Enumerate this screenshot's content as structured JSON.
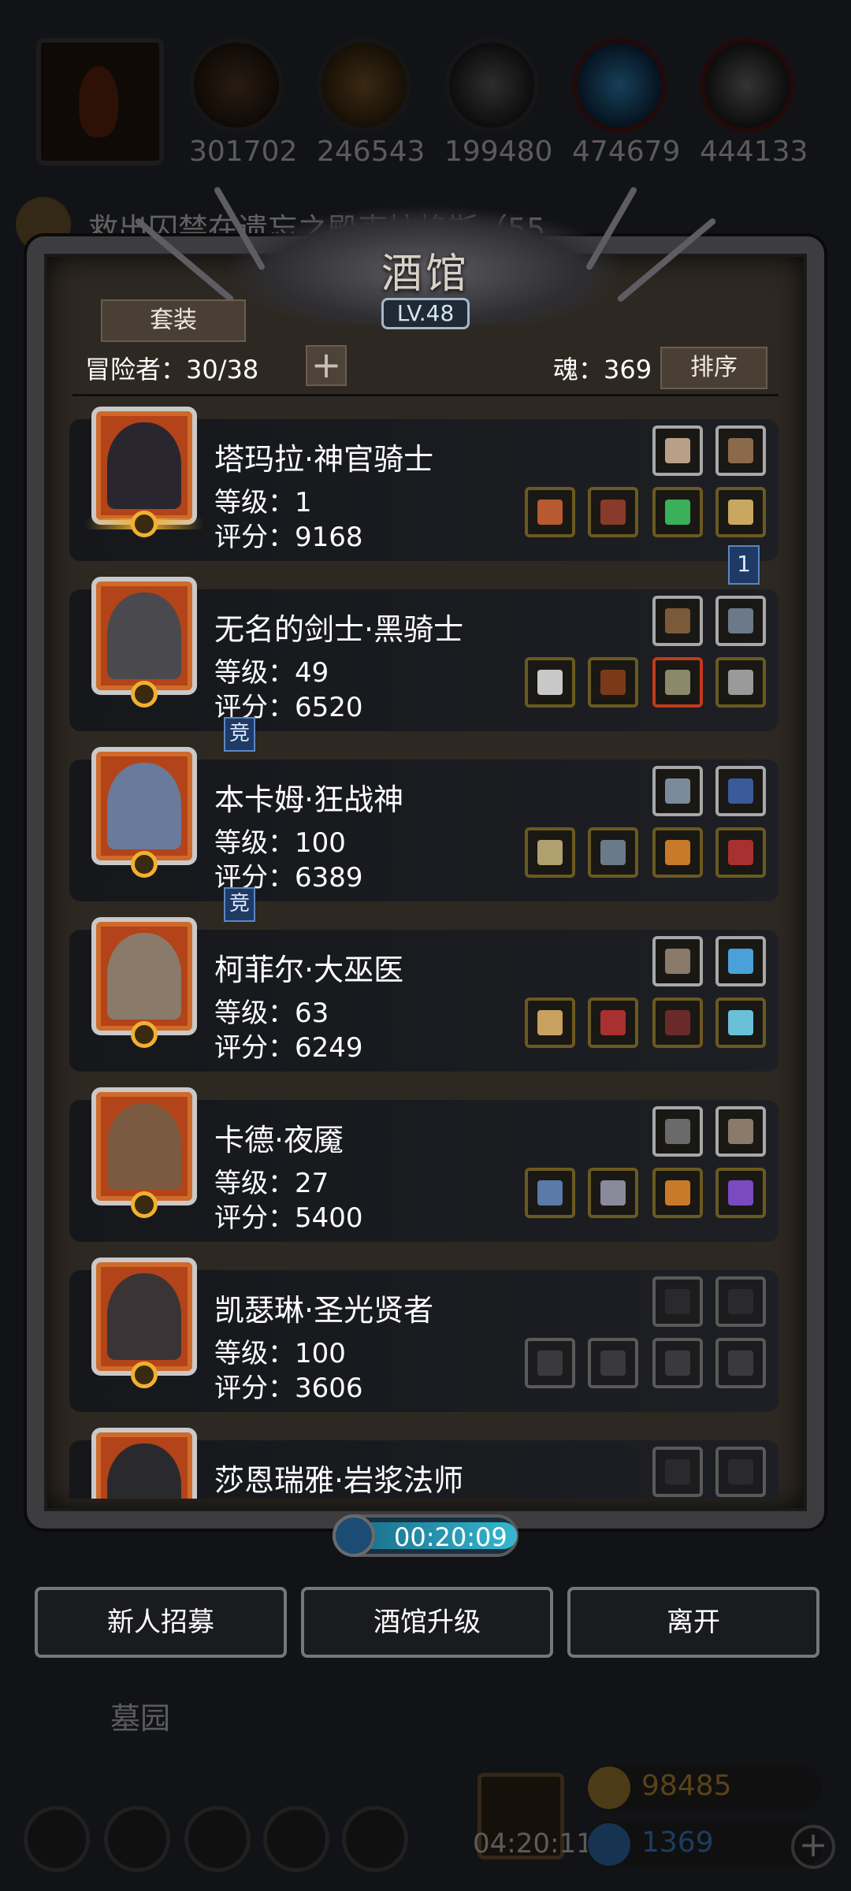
{
  "resources": [
    {
      "icon": "leather-icon",
      "value": "301702"
    },
    {
      "icon": "wood-icon",
      "value": "246543"
    },
    {
      "icon": "iron-icon",
      "value": "199480"
    },
    {
      "icon": "crystal-icon",
      "value": "474679"
    },
    {
      "icon": "stone-icon",
      "value": "444133"
    }
  ],
  "quest": {
    "text": "救出囚禁在遗忘之殿克拉格斯（55"
  },
  "panel": {
    "title": "酒馆",
    "level": "LV.48",
    "set_button": "套装",
    "adventurers": "冒险者：30/38",
    "souls": "魂：369",
    "sort_button": "排序"
  },
  "heroes": [
    {
      "name": "塔玛拉·神官骑士",
      "level": "等级：1",
      "score": "评分：9168",
      "face": "#2a2630",
      "gear": [
        "#b8a088",
        "#8a6a4a",
        "#b85a30",
        "#8a3a2a",
        "#3ab05a",
        "#c8a860"
      ],
      "gear_borders": [
        "silver",
        "silver",
        "gold",
        "gold",
        "gold",
        "gold"
      ]
    },
    {
      "name": "无名的剑士·黑骑士",
      "level": "等级：49",
      "score": "评分：6520",
      "face": "#4a4a4e",
      "gear": [
        "#7a5a3a",
        "#6a7a8a",
        "#c8c8c8",
        "#7a3a1a",
        "#8a8a6a",
        "#9a9a9a"
      ],
      "gear_borders": [
        "silver",
        "silver",
        "gold",
        "gold",
        "red",
        "gold"
      ]
    },
    {
      "name": "本卡姆·狂战神",
      "level": "等级：100",
      "score": "评分：6389",
      "face": "#6a7a9a",
      "gear": [
        "#7a8a9a",
        "#3a5a9a",
        "#b0a070",
        "#6a7a8a",
        "#c87a2a",
        "#a83030"
      ],
      "gear_borders": [
        "silver",
        "silver",
        "gold",
        "gold",
        "gold",
        "gold"
      ]
    },
    {
      "name": "柯菲尔·大巫医",
      "level": "等级：63",
      "score": "评分：6249",
      "face": "#8a7a6a",
      "gear": [
        "#8a7a6a",
        "#4aa0d8",
        "#c8a060",
        "#a83030",
        "#6a2a2a",
        "#6ac0d8"
      ],
      "gear_borders": [
        "silver",
        "silver",
        "gold",
        "gold",
        "gold",
        "gold"
      ]
    },
    {
      "name": "卡德·夜魇",
      "level": "等级：27",
      "score": "评分：5400",
      "face": "#7a5a40",
      "gear": [
        "#6a6a6a",
        "#8a7a6a",
        "#5a7aa8",
        "#8a8a9a",
        "#c87a2a",
        "#7a4ac0"
      ],
      "gear_borders": [
        "silver",
        "silver",
        "gold",
        "gold",
        "gold",
        "gold"
      ]
    },
    {
      "name": "凯瑟琳·圣光贤者",
      "level": "等级：100",
      "score": "评分：3606",
      "face": "#3a3436",
      "gear": [
        "#2a2a2c",
        "#2a2a2c",
        "#3a3a3c",
        "#3a3a3c",
        "#3a3a3c",
        "#3a3a3c"
      ],
      "gear_borders": [
        "empty",
        "empty",
        "empty",
        "empty",
        "empty",
        "empty"
      ]
    },
    {
      "name": "莎恩瑞雅·岩浆法师",
      "level": "",
      "score": "",
      "face": "#2a2a2e",
      "gear": [
        "#2a2a2c",
        "#2a2a2c"
      ],
      "gear_borders": [
        "empty",
        "empty"
      ]
    }
  ],
  "tags": {
    "rank_marker": "1",
    "compete": "竞"
  },
  "timer": {
    "value": "00:20:09"
  },
  "actions": {
    "recruit": "新人招募",
    "upgrade": "酒馆升级",
    "leave": "离开"
  },
  "background": {
    "place": "墓园",
    "gift_timer": "04:20:11",
    "gold": "98485",
    "gems": "1369"
  }
}
